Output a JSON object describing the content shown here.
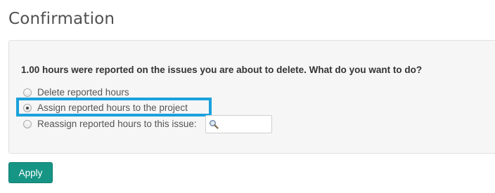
{
  "page": {
    "title": "Confirmation"
  },
  "form": {
    "question": "1.00 hours were reported on the issues you are about to delete. What do you want to do?",
    "options": [
      {
        "label": "Delete reported hours",
        "selected": false
      },
      {
        "label": "Assign reported hours to the project",
        "selected": true
      },
      {
        "label": "Reassign reported hours to this issue:",
        "selected": false
      }
    ],
    "issue_search": {
      "value": "",
      "icon": "magnifier-icon"
    },
    "apply_label": "Apply"
  },
  "colors": {
    "highlight_border": "#1aa1dc",
    "apply_button": "#169585",
    "box_background": "#f6f6f6"
  }
}
